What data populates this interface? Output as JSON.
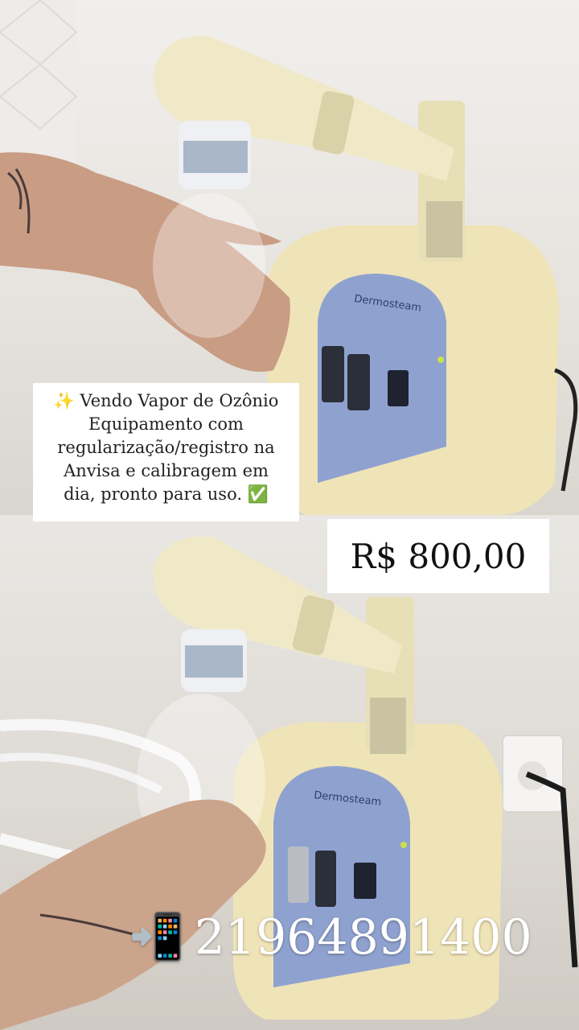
{
  "caption": {
    "line1": "✨ Vendo Vapor de Ozônio",
    "line2": "Equipamento com",
    "line3": "regularização/registro na",
    "line4": "Anvisa e calibragem em",
    "line5": "dia, pronto para uso. ✅"
  },
  "price": "R$ 800,00",
  "contact": {
    "icon": "📲",
    "phone": "21964891400"
  },
  "device": {
    "brand": "Dermosteam"
  },
  "colors": {
    "device_body": "#efe3b8",
    "panel": "#8fa2cf",
    "text_box": "#ffffff"
  }
}
